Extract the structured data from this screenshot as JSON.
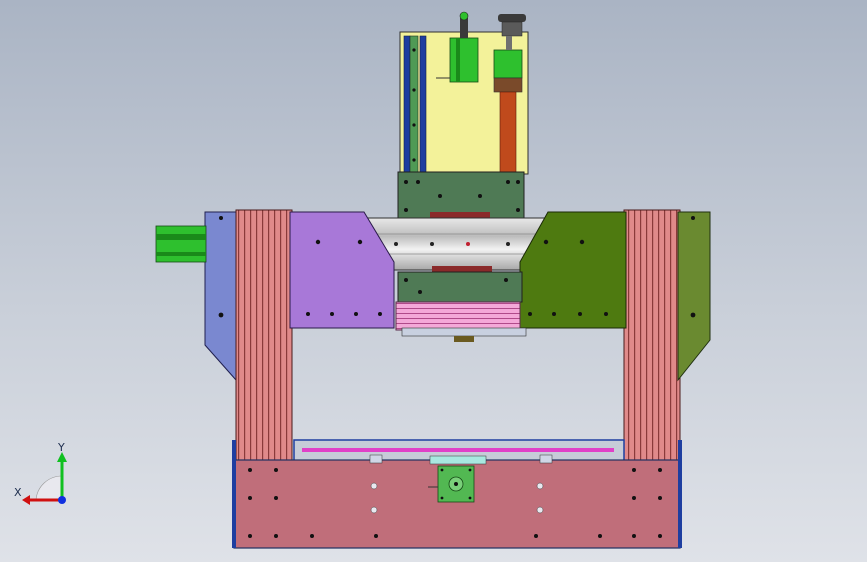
{
  "viewport": {
    "name": "cad-3d-viewport",
    "background_top": "#aab4c4",
    "background_bottom": "#dfe2e8"
  },
  "triad": {
    "x_label": "X",
    "y_label": "Y",
    "x_color": "#d01010",
    "y_color": "#10c020",
    "z_color": "#1030e0"
  },
  "model": {
    "colors": {
      "base": "#c06e7a",
      "aluminum_profile": "#e08a8a",
      "left_plate": "#a878d8",
      "right_plate": "#4e7a10",
      "side_plate_left": "#7a88d0",
      "side_plate_right": "#6a8a30",
      "z_housing": "#f3f29a",
      "z_carriage": "#4f7a55",
      "motor_green": "#2ec02e",
      "lead_screw": "#c04a1c",
      "linear_rail": "#1e3ea0",
      "gantry_beam": "#dcdcdc",
      "stepper_mount": "#52b852"
    }
  }
}
